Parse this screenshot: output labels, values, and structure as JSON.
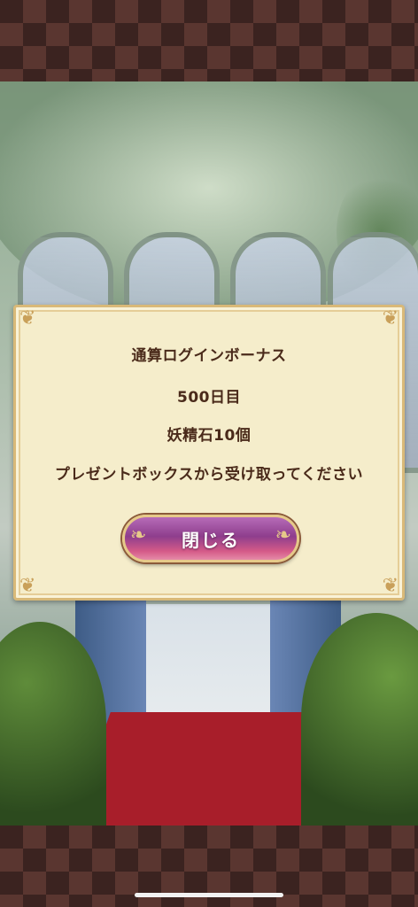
{
  "dialog": {
    "line1": "通算ログインボーナス",
    "line2": "500日目",
    "line3": "妖精石10個",
    "line4": "プレゼントボックスから受け取ってください",
    "close_label": "閉じる"
  },
  "colors": {
    "panel": "#f5edcb",
    "panel_border": "#d9b978",
    "text": "#4a2a1a",
    "button_top": "#8e3e8d",
    "button_bottom": "#e58aa8",
    "carpet": "#a81e2a",
    "band": "#3b2320"
  },
  "icons": {
    "corner": "ornament-flourish",
    "button_swirl": "swirl-ornament"
  }
}
